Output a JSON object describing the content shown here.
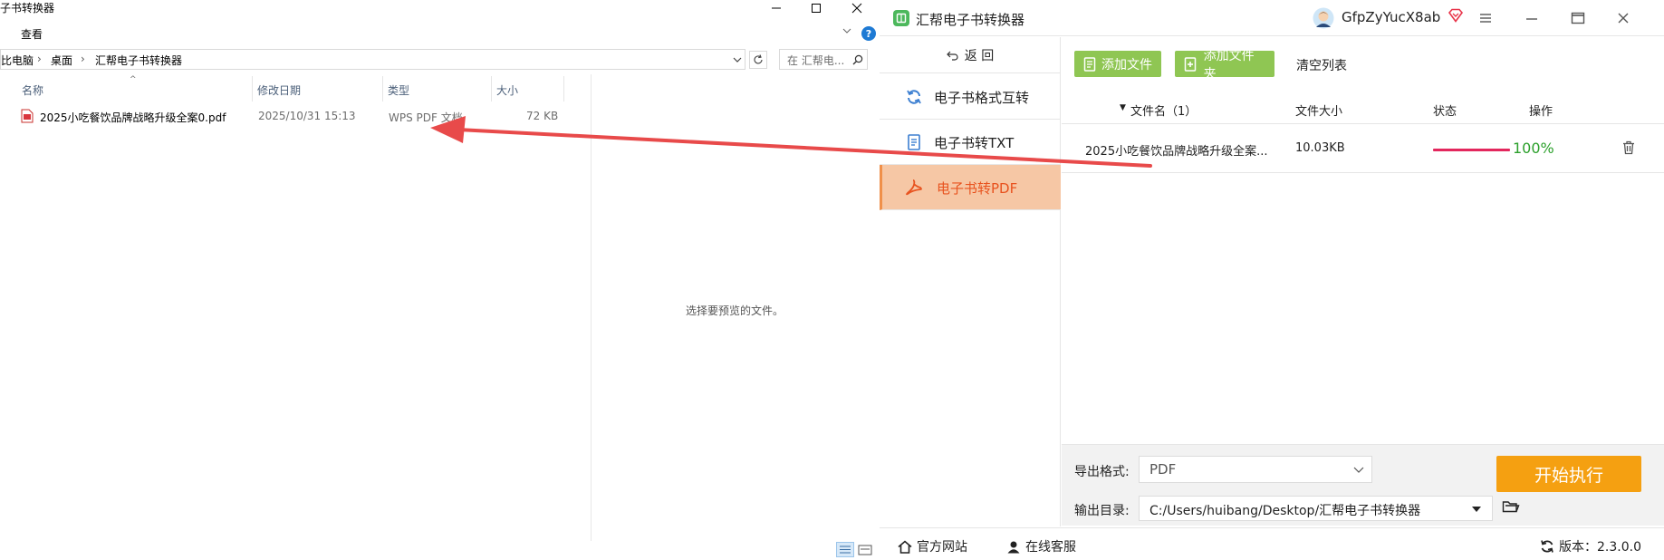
{
  "explorer": {
    "window_title": "子书转换器",
    "menu": {
      "view": "查看"
    },
    "help_symbol": "?",
    "address": {
      "crumbs": [
        "比电脑",
        "桌面",
        "汇帮电子书转换器"
      ]
    },
    "search": {
      "placeholder": "在 汇帮电..."
    },
    "columns": {
      "name": "名称",
      "modified": "修改日期",
      "type": "类型",
      "size": "大小"
    },
    "files": [
      {
        "name": "2025小吃餐饮品牌战略升级全案0.pdf",
        "modified": "2025/10/31 15:13",
        "type": "WPS PDF 文档",
        "size": "72 KB"
      }
    ],
    "preview_message": "选择要预览的文件。"
  },
  "app": {
    "title": "汇帮电子书转换器",
    "user": {
      "name": "GfpZyYucX8ab"
    },
    "sidebar": {
      "back": "返 回",
      "items": [
        {
          "label": "电子书格式互转",
          "icon": "refresh-icon",
          "active": false
        },
        {
          "label": "电子书转TXT",
          "icon": "document-icon",
          "active": false
        },
        {
          "label": "电子书转PDF",
          "icon": "pdf-icon",
          "active": true
        }
      ]
    },
    "toolbar": {
      "add_file": "添加文件",
      "add_folder": "添加文件夹",
      "clear_list": "清空列表"
    },
    "table": {
      "headers": {
        "filename": "文件名（1）",
        "filesize": "文件大小",
        "status": "状态",
        "action": "操作"
      },
      "rows": [
        {
          "filename": "2025小吃餐饮品牌战略升级全案...",
          "filesize": "10.03KB",
          "progress": 1.0,
          "progress_text": "100%"
        }
      ]
    },
    "output": {
      "format_label": "导出格式:",
      "format_value": "PDF",
      "dir_label": "输出目录:",
      "dir_value": "C:/Users/huibang/Desktop/汇帮电子书转换器"
    },
    "start_button": "开始执行",
    "footer": {
      "website": "官方网站",
      "support": "在线客服",
      "version": "版本：2.3.0.0"
    },
    "colors": {
      "accent_green": "#8fc653",
      "start_orange": "#f5a011",
      "active_nav": "#f6c7a5",
      "progress": "#e3275d",
      "percent_green": "#2ca02c",
      "annotation_arrow": "#e84a4a"
    }
  }
}
